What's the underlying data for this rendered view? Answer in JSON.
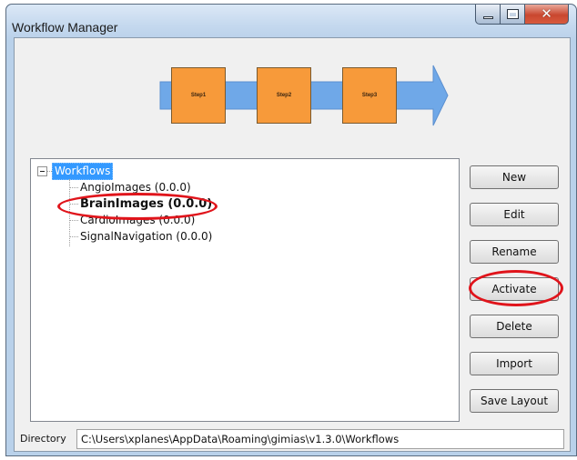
{
  "window": {
    "title": "Workflow Manager",
    "close_glyph": "✕"
  },
  "pipeline": {
    "steps": [
      "Step1",
      "Step2",
      "Step3"
    ],
    "arrow_color": "#6fa8e8",
    "step_color": "#f79a3a"
  },
  "tree": {
    "root": "Workflows",
    "items": [
      {
        "label": "AngioImages (0.0.0)",
        "active": false
      },
      {
        "label": "BrainImages (0.0.0)",
        "active": true
      },
      {
        "label": "CardioImages (0.0.0)",
        "active": false
      },
      {
        "label": "SignalNavigation (0.0.0)",
        "active": false
      }
    ]
  },
  "buttons": {
    "new": "New",
    "edit": "Edit",
    "rename": "Rename",
    "activate": "Activate",
    "delete": "Delete",
    "import": "Import",
    "save_layout": "Save Layout"
  },
  "directory": {
    "label": "Directory",
    "value": "C:\\Users\\xplanes\\AppData\\Roaming\\gimias\\v1.3.0\\Workflows"
  },
  "colors": {
    "annotation": "#e0141b",
    "selection": "#3399ff"
  }
}
